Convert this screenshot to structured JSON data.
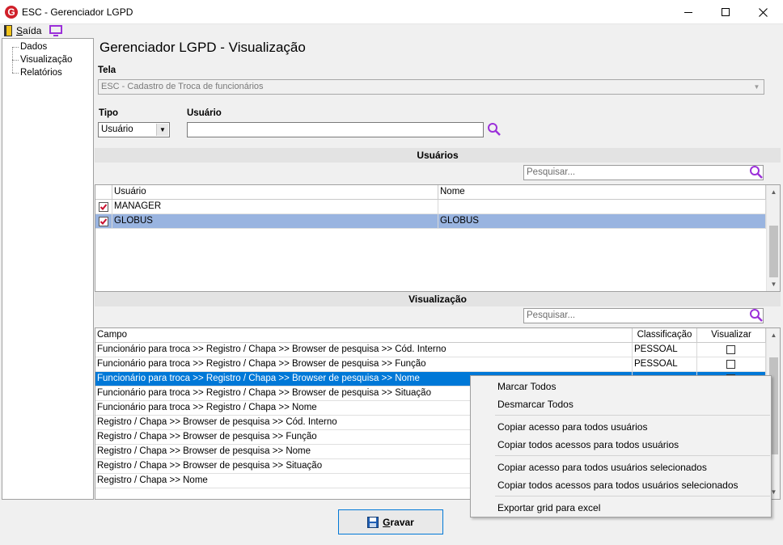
{
  "window": {
    "title": "ESC - Gerenciador LGPD",
    "logo_letter": "G"
  },
  "menubar": {
    "exit_label": "Saída"
  },
  "sidebar": {
    "items": [
      "Dados",
      "Visualização",
      "Relatórios"
    ]
  },
  "page_title": "Gerenciador LGPD - Visualização",
  "tela": {
    "label": "Tela",
    "value": "ESC - Cadastro de Troca de funcionários"
  },
  "tipo": {
    "label": "Tipo",
    "value": "Usuário"
  },
  "usuario": {
    "label": "Usuário",
    "value": ""
  },
  "usuarios_section": {
    "title": "Usuários",
    "search_placeholder": "Pesquisar...",
    "columns": [
      "Usuário",
      "Nome"
    ],
    "rows": [
      {
        "usuario": "MANAGER",
        "nome": "",
        "checked": true
      },
      {
        "usuario": "GLOBUS",
        "nome": "GLOBUS",
        "checked": true
      }
    ]
  },
  "visualizacao_section": {
    "title": "Visualização",
    "search_placeholder": "Pesquisar...",
    "columns": [
      "Campo",
      "Classificação",
      "Visualizar"
    ],
    "rows": [
      {
        "campo": "Funcionário para troca >> Registro / Chapa >> Browser de pesquisa >> Cód. Interno",
        "classificacao": "PESSOAL"
      },
      {
        "campo": "Funcionário para troca >> Registro / Chapa >> Browser de pesquisa >> Função",
        "classificacao": "PESSOAL"
      },
      {
        "campo": "Funcionário para troca >> Registro / Chapa >> Browser de pesquisa >> Nome",
        "classificacao": ""
      },
      {
        "campo": "Funcionário para troca >> Registro / Chapa >> Browser de pesquisa >> Situação",
        "classificacao": ""
      },
      {
        "campo": "Funcionário para troca >> Registro / Chapa >> Nome",
        "classificacao": ""
      },
      {
        "campo": "Registro / Chapa >> Browser de pesquisa >> Cód. Interno",
        "classificacao": ""
      },
      {
        "campo": "Registro / Chapa >> Browser de pesquisa >> Função",
        "classificacao": ""
      },
      {
        "campo": "Registro / Chapa >> Browser de pesquisa >> Nome",
        "classificacao": ""
      },
      {
        "campo": "Registro / Chapa >> Browser de pesquisa >> Situação",
        "classificacao": ""
      },
      {
        "campo": "Registro / Chapa >> Nome",
        "classificacao": ""
      }
    ]
  },
  "save_button": {
    "label": "Gravar"
  },
  "context_menu": {
    "items": [
      "Marcar Todos",
      "Desmarcar Todos",
      "Copiar acesso para todos usuários",
      "Copiar todos acessos para todos usuários",
      "Copiar acesso para todos usuários selecionados",
      "Copiar todos acessos para todos usuários selecionados",
      "Exportar grid para excel"
    ]
  },
  "colors": {
    "selection": "#0078d7",
    "row_selected": "#99b4e0",
    "accent_purple": "#9b30d9",
    "checkbox_red": "#c8102e"
  }
}
